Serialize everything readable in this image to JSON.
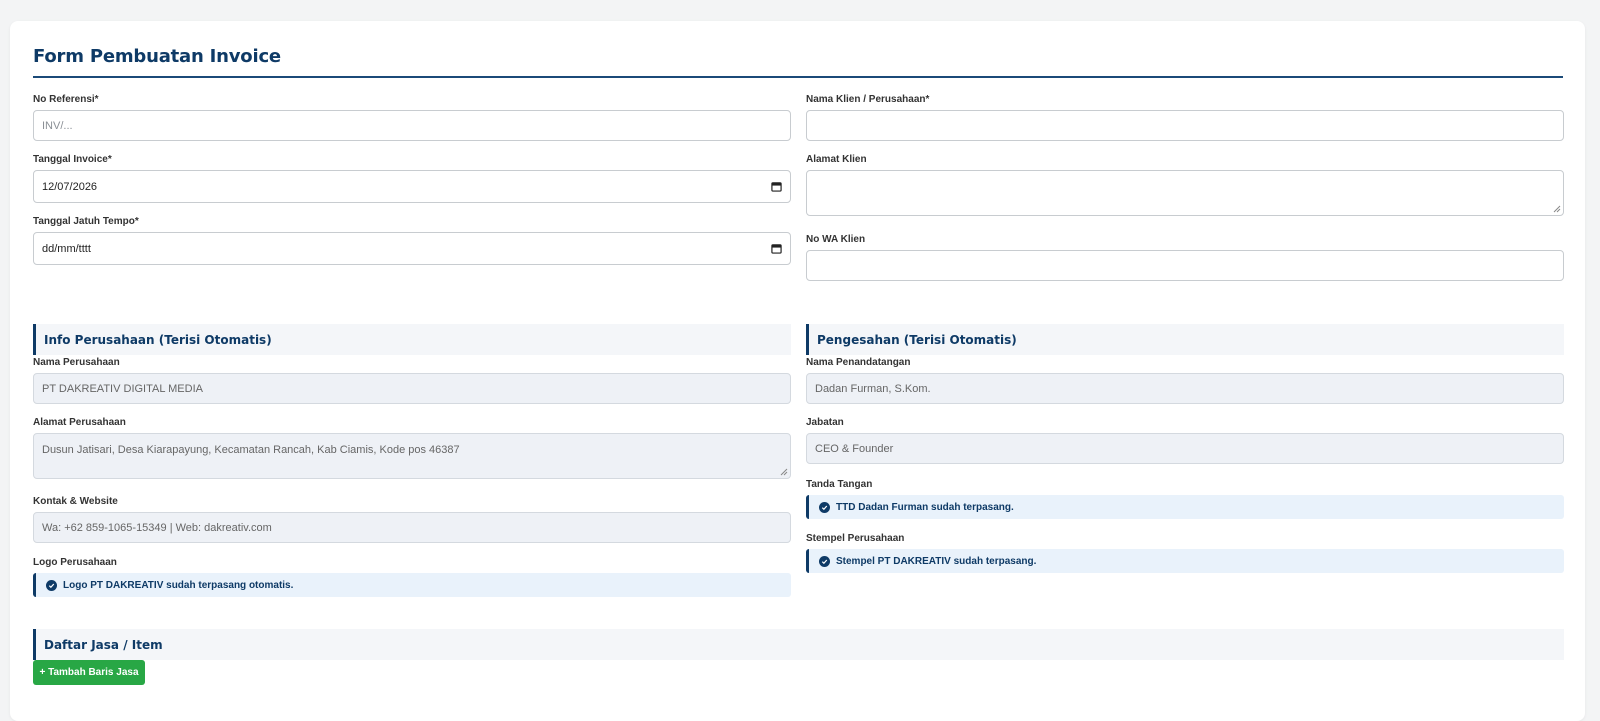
{
  "page_title": "Form Pembuatan Invoice",
  "fields": {
    "no_referensi": {
      "label": "No Referensi*",
      "placeholder": "INV/..."
    },
    "tanggal_invoice": {
      "label": "Tanggal Invoice*",
      "value": "12/07/2026"
    },
    "tanggal_jatuh_tempo": {
      "label": "Tanggal Jatuh Tempo*",
      "value": "dd/mm/tttt"
    },
    "nama_klien": {
      "label": "Nama Klien / Perusahaan*",
      "value": ""
    },
    "alamat_klien": {
      "label": "Alamat Klien",
      "value": ""
    },
    "no_wa_klien": {
      "label": "No WA Klien",
      "value": ""
    }
  },
  "info_perusahaan": {
    "heading": "Info Perusahaan (Terisi Otomatis)",
    "nama_label": "Nama Perusahaan",
    "nama_value": "PT DAKREATIV DIGITAL MEDIA",
    "alamat_label": "Alamat Perusahaan",
    "alamat_value": "Dusun Jatisari, Desa Kiarapayung, Kecamatan Rancah, Kab Ciamis, Kode pos 46387",
    "kontak_label": "Kontak & Website",
    "kontak_value": "Wa: +62 859-1065-15349 | Web: dakreativ.com",
    "logo_label": "Logo Perusahaan",
    "logo_notice": "Logo PT DAKREATIV sudah terpasang otomatis."
  },
  "pengesahan": {
    "heading": "Pengesahan (Terisi Otomatis)",
    "penandatangan_label": "Nama Penandatangan",
    "penandatangan_value": "Dadan Furman, S.Kom.",
    "jabatan_label": "Jabatan",
    "jabatan_value": "CEO & Founder",
    "ttd_label": "Tanda Tangan",
    "ttd_notice": "TTD Dadan Furman sudah terpasang.",
    "stempel_label": "Stempel Perusahaan",
    "stempel_notice": "Stempel PT DAKREATIV sudah terpasang."
  },
  "daftar_jasa": {
    "heading": "Daftar Jasa / Item",
    "add_button": "+ Tambah Baris Jasa"
  },
  "colors": {
    "primary": "#0e3a66",
    "success": "#28a745",
    "readonly_bg": "#eef1f6"
  }
}
